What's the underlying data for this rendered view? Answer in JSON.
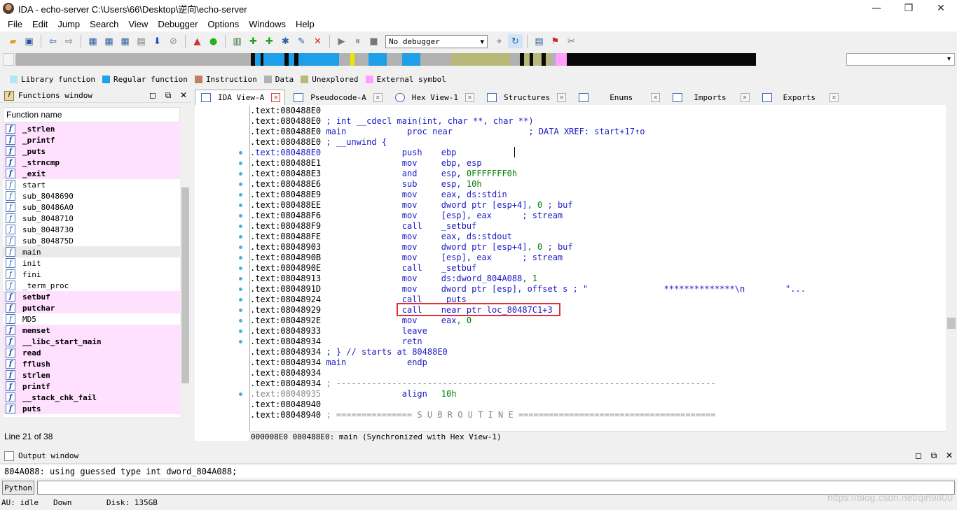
{
  "window": {
    "title": "IDA - echo-server C:\\Users\\66\\Desktop\\逆向\\echo-server",
    "minimize": "—",
    "maximize": "❐",
    "close": "✕"
  },
  "menu": [
    "File",
    "Edit",
    "Jump",
    "Search",
    "View",
    "Debugger",
    "Options",
    "Windows",
    "Help"
  ],
  "toolbar": {
    "debugger_select": "No debugger",
    "icons": [
      "open-icon",
      "save-icon",
      "back-icon",
      "forward-icon",
      "binary-icon",
      "hex-icon",
      "data-icon",
      "text-icon",
      "jump-down-icon",
      "no-entry-icon",
      "graph-warn-icon",
      "green-circle-icon",
      "create-func-icon",
      "add-icon",
      "add-enum-icon",
      "struct-icon",
      "edit-icon",
      "delete-icon",
      "play-icon",
      "pause-icon",
      "stop-icon",
      "trace-icon",
      "refresh-icon",
      "bookmark-icon",
      "flag-icon",
      "tools-icon"
    ]
  },
  "navband": {
    "segments": [
      {
        "w": 336,
        "c": "#b2b2b2"
      },
      {
        "w": 6,
        "c": "#0a0a0a"
      },
      {
        "w": 8,
        "c": "#1e9fe8"
      },
      {
        "w": 4,
        "c": "#0a0a0a"
      },
      {
        "w": 30,
        "c": "#1e9fe8"
      },
      {
        "w": 6,
        "c": "#0a0a0a"
      },
      {
        "w": 8,
        "c": "#1e9fe8"
      },
      {
        "w": 6,
        "c": "#0a0a0a"
      },
      {
        "w": 58,
        "c": "#1e9fe8"
      },
      {
        "w": 16,
        "c": "#b2b2b2"
      },
      {
        "w": 6,
        "c": "#e8e800"
      },
      {
        "w": 20,
        "c": "#b2b2b2"
      },
      {
        "w": 26,
        "c": "#1e9fe8"
      },
      {
        "w": 22,
        "c": "#b2b2b2"
      },
      {
        "w": 26,
        "c": "#1e9fe8"
      },
      {
        "w": 44,
        "c": "#b2b2b2"
      },
      {
        "w": 84,
        "c": "#b8b878"
      },
      {
        "w": 14,
        "c": "#b2b2b2"
      },
      {
        "w": 6,
        "c": "#0a0a0a"
      },
      {
        "w": 8,
        "c": "#b8b878"
      },
      {
        "w": 5,
        "c": "#0a0a0a"
      },
      {
        "w": 12,
        "c": "#b8b878"
      },
      {
        "w": 6,
        "c": "#0a0a0a"
      },
      {
        "w": 6,
        "c": "#b8b878"
      },
      {
        "w": 8,
        "c": "#b2b2b2"
      },
      {
        "w": 16,
        "c": "#ff9fff"
      },
      {
        "w": 270,
        "c": "#0a0a0a"
      }
    ],
    "arrow": "▾"
  },
  "legend": [
    {
      "label": "Library function",
      "color": "#aee8f8"
    },
    {
      "label": "Regular function",
      "color": "#1e9fe8"
    },
    {
      "label": "Instruction",
      "color": "#c08060"
    },
    {
      "label": "Data",
      "color": "#b2b2b2"
    },
    {
      "label": "Unexplored",
      "color": "#b8b878"
    },
    {
      "label": "External symbol",
      "color": "#ff9fff"
    }
  ],
  "functions_window": {
    "title": "Functions window",
    "column": "Function name",
    "status": "Line 21 of 38",
    "functions": [
      {
        "name": "_strlen",
        "lib": true
      },
      {
        "name": "_printf",
        "lib": true
      },
      {
        "name": "_puts",
        "lib": true
      },
      {
        "name": "_strncmp",
        "lib": true
      },
      {
        "name": "_exit",
        "lib": true
      },
      {
        "name": "start",
        "lib": false
      },
      {
        "name": "sub_8048690",
        "lib": false
      },
      {
        "name": "sub_80486A0",
        "lib": false
      },
      {
        "name": "sub_8048710",
        "lib": false
      },
      {
        "name": "sub_8048730",
        "lib": false
      },
      {
        "name": "sub_804875D",
        "lib": false
      },
      {
        "name": "main",
        "lib": false,
        "selected": true
      },
      {
        "name": "init",
        "lib": false
      },
      {
        "name": "fini",
        "lib": false
      },
      {
        "name": "_term_proc",
        "lib": false
      },
      {
        "name": "setbuf",
        "lib": true
      },
      {
        "name": "putchar",
        "lib": true
      },
      {
        "name": "MD5",
        "lib": false
      },
      {
        "name": "memset",
        "lib": true
      },
      {
        "name": "__libc_start_main",
        "lib": true
      },
      {
        "name": "read",
        "lib": true
      },
      {
        "name": "fflush",
        "lib": true
      },
      {
        "name": "strlen",
        "lib": true
      },
      {
        "name": "printf",
        "lib": true
      },
      {
        "name": "__stack_chk_fail",
        "lib": true
      },
      {
        "name": "puts",
        "lib": true
      }
    ]
  },
  "tabs": [
    {
      "label": "IDA View-A",
      "active": true
    },
    {
      "label": "Pseudocode-A",
      "active": false
    },
    {
      "label": "Hex View-1",
      "active": false
    },
    {
      "label": "Structures",
      "active": false
    },
    {
      "label": "Enums",
      "active": false
    },
    {
      "label": "Imports",
      "active": false
    },
    {
      "label": "Exports",
      "active": false
    }
  ],
  "disasm": {
    "lines": [
      {
        "addr": ".text:080488E0",
        "rest": ""
      },
      {
        "addr": ".text:080488E0",
        "rest": " ; int __cdecl main(int, char **, char **)",
        "cls": "cm"
      },
      {
        "addr": ".text:080488E0",
        "rest": " main            proc near               ; DATA XREF: start+17↑o",
        "cls": "mainline"
      },
      {
        "addr": ".text:080488E0",
        "rest": " ; __unwind {",
        "cls": "cm"
      },
      {
        "addr": ".text:080488E0",
        "mn": "push",
        "ops": "ebp",
        "hl": true
      },
      {
        "addr": ".text:080488E1",
        "mn": "mov",
        "ops": "ebp, esp"
      },
      {
        "addr": ".text:080488E3",
        "mn": "and",
        "ops": "esp, 0FFFFFFF0h"
      },
      {
        "addr": ".text:080488E6",
        "mn": "sub",
        "ops": "esp, 10h"
      },
      {
        "addr": ".text:080488E9",
        "mn": "mov",
        "ops": "eax, ds:stdin"
      },
      {
        "addr": ".text:080488EE",
        "mn": "mov",
        "ops": "dword ptr [esp+4], 0 ; buf"
      },
      {
        "addr": ".text:080488F6",
        "mn": "mov",
        "ops": "[esp], eax      ; stream"
      },
      {
        "addr": ".text:080488F9",
        "mn": "call",
        "ops": "_setbuf"
      },
      {
        "addr": ".text:080488FE",
        "mn": "mov",
        "ops": "eax, ds:stdout"
      },
      {
        "addr": ".text:08048903",
        "mn": "mov",
        "ops": "dword ptr [esp+4], 0 ; buf"
      },
      {
        "addr": ".text:0804890B",
        "mn": "mov",
        "ops": "[esp], eax      ; stream"
      },
      {
        "addr": ".text:0804890E",
        "mn": "call",
        "ops": "_setbuf"
      },
      {
        "addr": ".text:08048913",
        "mn": "mov",
        "ops": "ds:dword_804A088, 1"
      },
      {
        "addr": ".text:0804891D",
        "mn": "mov",
        "ops": "dword ptr [esp], offset s ; \"               **************\\n        \"..."
      },
      {
        "addr": ".text:08048924",
        "mn": "call",
        "ops": "_puts"
      },
      {
        "addr": ".text:08048929",
        "mn": "call",
        "ops": "near ptr loc_80487C1+3"
      },
      {
        "addr": ".text:0804892E",
        "mn": "mov",
        "ops": "eax, 0"
      },
      {
        "addr": ".text:08048933",
        "mn": "leave",
        "ops": ""
      },
      {
        "addr": ".text:08048934",
        "mn": "retn",
        "ops": ""
      },
      {
        "addr": ".text:08048934",
        "rest": " ; } // starts at 80488E0",
        "cls": "cm"
      },
      {
        "addr": ".text:08048934",
        "rest": " main            endp",
        "cls": "mainend"
      },
      {
        "addr": ".text:08048934",
        "rest": ""
      },
      {
        "addr": ".text:08048934",
        "rest": " ; ---------------------------------------------------------------------------",
        "cls": "sep"
      },
      {
        "addr": ".text:08048935",
        "mn": "align",
        "ops": "10h",
        "gray": true
      },
      {
        "addr": ".text:08048940",
        "rest": ""
      },
      {
        "addr": ".text:08048940",
        "rest": " ; =============== S U B R O U T I N E =======================================",
        "cls": "sep"
      }
    ],
    "status": "000008E0 080488E0: main (Synchronized with Hex View-1)"
  },
  "output_window": {
    "title": "Output window",
    "text": "804A088: using guessed type int dword_804A088;"
  },
  "python_button": "Python",
  "statusbar": {
    "au": "AU:  idle",
    "dir": "Down",
    "disk": "Disk: 135GB"
  },
  "watermark": "https://blog.csdn.net/qin9800"
}
